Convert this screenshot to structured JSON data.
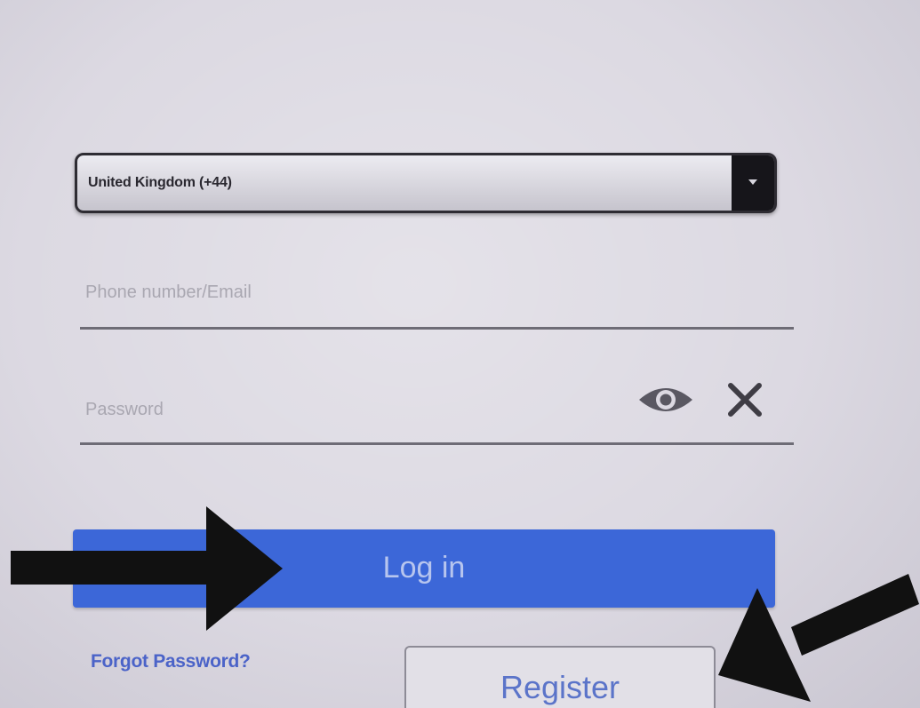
{
  "form": {
    "country_select": {
      "value": "United Kingdom (+44)"
    },
    "phone_email": {
      "placeholder": "Phone number/Email"
    },
    "password": {
      "placeholder": "Password"
    },
    "icons": {
      "show_password": "eye-icon",
      "clear_field": "close-icon"
    },
    "login_label": "Log in",
    "forgot_password_label": "Forgot Password?",
    "register_label": "Register"
  },
  "colors": {
    "primary": "#3c67d8",
    "link": "#4b63c8",
    "background": "#dcd9e2",
    "annotation_arrows": "#111111"
  }
}
